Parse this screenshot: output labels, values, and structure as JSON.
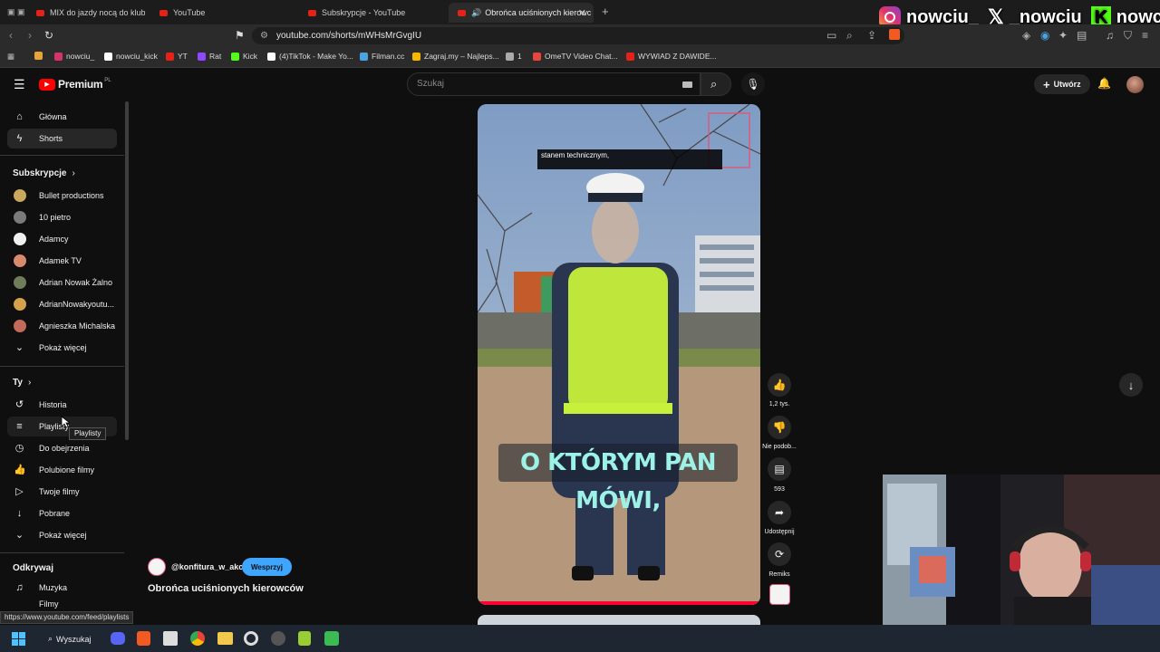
{
  "tabs": [
    {
      "label": "MIX do jazdy nocą do klubu E"
    },
    {
      "label": "YouTube"
    },
    {
      "label": "Subskrypcje - YouTube"
    },
    {
      "label": "Obrońca uciśnionych kierowc"
    }
  ],
  "address_bar": {
    "url": "youtube.com/shorts/mWHsMrGvgIU"
  },
  "bookmarks": [
    {
      "label": "nowciu_",
      "color": "#d6336c"
    },
    {
      "label": "nowciu_kick",
      "color": "#ffffff"
    },
    {
      "label": "YT",
      "color": "#e62117"
    },
    {
      "label": "Rat",
      "color": "#9146ff"
    },
    {
      "label": "Kick",
      "color": "#53fc18"
    },
    {
      "label": "(4)TikTok - Make Yo...",
      "color": "#ffffff"
    },
    {
      "label": "Filman.cc",
      "color": "#4aa3df"
    },
    {
      "label": "Zagraj.my – Najleps...",
      "color": "#f5b700"
    },
    {
      "label": "1",
      "color": "#aaaaaa"
    },
    {
      "label": "OmeTV Video Chat...",
      "color": "#e8453c"
    },
    {
      "label": "WYWIAD Z DAWIDE...",
      "color": "#e62117"
    }
  ],
  "overlay": {
    "instagram": "nowciu_",
    "x": "_nowciu",
    "kick": "nowciu"
  },
  "youtube": {
    "logo": "Premium",
    "logo_region": "PL",
    "search_placeholder": "Szukaj",
    "create_label": "Utwórz"
  },
  "sidebar": {
    "main": [
      {
        "label": "Główna",
        "icon": "home-icon"
      },
      {
        "label": "Shorts",
        "icon": "shorts-icon",
        "active": true
      }
    ],
    "subscriptions_heading": "Subskrypcje",
    "subscriptions": [
      {
        "label": "Bullet productions",
        "color": "#c9a75c"
      },
      {
        "label": "10 pietro",
        "color": "#7a7a7a"
      },
      {
        "label": "Adamcy",
        "color": "#f0f0f0"
      },
      {
        "label": "Adamek TV",
        "color": "#d98a6c"
      },
      {
        "label": "Adrian Nowak Żalno",
        "color": "#6f7d5b"
      },
      {
        "label": "AdrianNowakyoutu...",
        "color": "#d4a24a"
      },
      {
        "label": "Agnieszka Michalska",
        "color": "#c46a5a"
      }
    ],
    "show_more": "Pokaż więcej",
    "you_heading": "Ty",
    "you": [
      {
        "label": "Historia",
        "icon": "history-icon"
      },
      {
        "label": "Playlisty",
        "icon": "playlist-icon"
      },
      {
        "label": "Do obejrzenia",
        "icon": "watch-later-icon"
      },
      {
        "label": "Polubione filmy",
        "icon": "like-icon"
      },
      {
        "label": "Twoje filmy",
        "icon": "your-videos-icon"
      },
      {
        "label": "Pobrane",
        "icon": "download-icon"
      }
    ],
    "you_show_more": "Pokaż więcej",
    "explore_heading": "Odkrywaj",
    "explore": [
      {
        "label": "Muzyka",
        "icon": "music-icon"
      },
      {
        "label": "Filmy",
        "icon": "film-icon"
      }
    ],
    "tooltip": "Playlisty"
  },
  "short": {
    "caption_top": [
      "stanem technicznym,"
    ],
    "subtitle": "O KTÓRYM PAN MÓWI,",
    "channel": "@konfitura_w_akcji",
    "support_label": "Wesprzyj",
    "title": "Obrońca uciśnionych kierowców",
    "likes": "1,2 tys.",
    "dislike_label": "Nie podob...",
    "comments": "593",
    "share_label": "Udostępnij",
    "remix_label": "Remiks"
  },
  "status_url": "https://www.youtube.com/feed/playlists",
  "taskbar": {
    "search_label": "Wyszukaj"
  }
}
